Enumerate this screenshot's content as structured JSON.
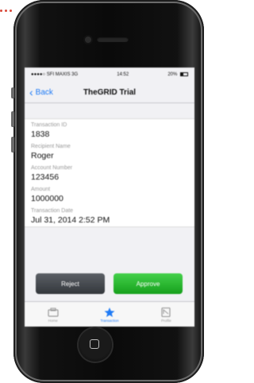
{
  "status_bar": {
    "carrier": "●●●●○ SFI MAXIS 3G",
    "time": "14:52",
    "battery": "20%"
  },
  "nav": {
    "back_label": "Back",
    "title": "TheGRID Trial"
  },
  "fields": [
    {
      "label": "Transaction ID",
      "value": "1838"
    },
    {
      "label": "Recipient Name",
      "value": "Roger"
    },
    {
      "label": "Account Number",
      "value": "123456"
    },
    {
      "label": "Amount",
      "value": "1000000"
    },
    {
      "label": "Transaction Date",
      "value": "Jul 31, 2014 2:52 PM"
    }
  ],
  "actions": {
    "reject_label": "Reject",
    "approve_label": "Approve"
  },
  "tabs": [
    {
      "label": "Home",
      "icon": "home-icon",
      "active": false
    },
    {
      "label": "Transaction",
      "icon": "star-icon",
      "active": true
    },
    {
      "label": "Profile",
      "icon": "profile-icon",
      "active": false
    }
  ],
  "colors": {
    "accent": "#1f7bf6",
    "approve": "#1faa24",
    "reject": "#44484d",
    "phone_body": "#0d0d0d"
  }
}
